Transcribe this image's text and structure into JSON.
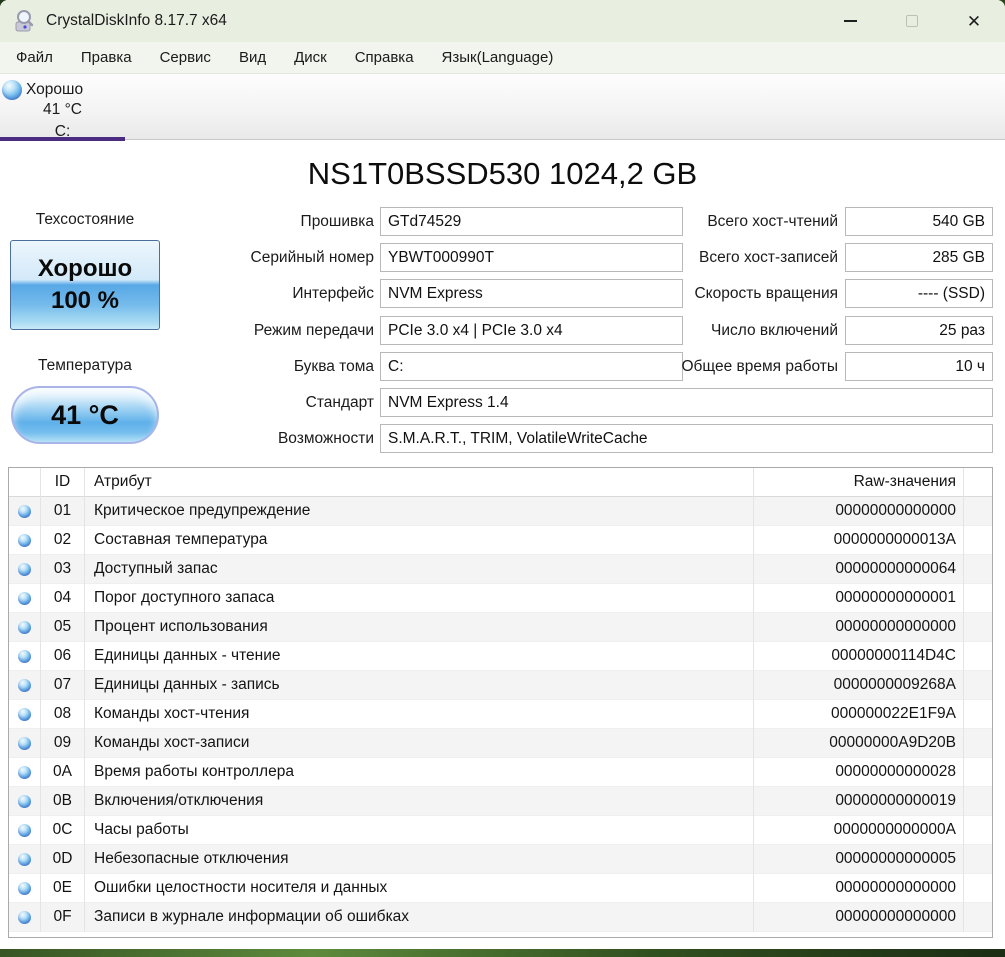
{
  "window": {
    "title": "CrystalDiskInfo 8.17.7 x64",
    "controls": {
      "close": "✕"
    }
  },
  "menu": {
    "items": [
      "Файл",
      "Правка",
      "Сервис",
      "Вид",
      "Диск",
      "Справка",
      "Язык(Language)"
    ]
  },
  "drive_tab": {
    "status": "Хорошо",
    "temperature": "41 °C",
    "letter": "C:"
  },
  "drive": {
    "model_title": "NS1T0BSSD530 1024,2 GB",
    "health": {
      "label": "Техсостояние",
      "status": "Хорошо",
      "percent": "100 %"
    },
    "temperature": {
      "label": "Температура",
      "value": "41 °C"
    },
    "fields_left": [
      {
        "label": "Прошивка",
        "value": "GTd74529"
      },
      {
        "label": "Серийный номер",
        "value": "YBWT000990T"
      },
      {
        "label": "Интерфейс",
        "value": "NVM Express"
      },
      {
        "label": "Режим передачи",
        "value": "PCIe 3.0 x4 | PCIe 3.0 x4"
      },
      {
        "label": "Буква тома",
        "value": "C:"
      },
      {
        "label": "Стандарт",
        "value": "NVM Express 1.4"
      },
      {
        "label": "Возможности",
        "value": "S.M.A.R.T., TRIM, VolatileWriteCache"
      }
    ],
    "fields_right": [
      {
        "label": "Всего хост-чтений",
        "value": "540 GB"
      },
      {
        "label": "Всего хост-записей",
        "value": "285 GB"
      },
      {
        "label": "Скорость вращения",
        "value": "---- (SSD)"
      },
      {
        "label": "Число включений",
        "value": "25 раз"
      },
      {
        "label": "Общее время работы",
        "value": "10 ч"
      }
    ]
  },
  "smart_table": {
    "headers": {
      "id": "ID",
      "attribute": "Атрибут",
      "raw": "Raw-значения"
    },
    "rows": [
      {
        "id": "01",
        "name": "Критическое предупреждение",
        "raw": "00000000000000"
      },
      {
        "id": "02",
        "name": "Составная температура",
        "raw": "0000000000013A"
      },
      {
        "id": "03",
        "name": "Доступный запас",
        "raw": "00000000000064"
      },
      {
        "id": "04",
        "name": "Порог доступного запаса",
        "raw": "00000000000001"
      },
      {
        "id": "05",
        "name": "Процент использования",
        "raw": "00000000000000"
      },
      {
        "id": "06",
        "name": "Единицы данных - чтение",
        "raw": "00000000114D4C"
      },
      {
        "id": "07",
        "name": "Единицы данных - запись",
        "raw": "0000000009268A"
      },
      {
        "id": "08",
        "name": "Команды хост-чтения",
        "raw": "000000022E1F9A"
      },
      {
        "id": "09",
        "name": "Команды хост-записи",
        "raw": "00000000A9D20B"
      },
      {
        "id": "0A",
        "name": "Время работы контроллера",
        "raw": "00000000000028"
      },
      {
        "id": "0B",
        "name": "Включения/отключения",
        "raw": "00000000000019"
      },
      {
        "id": "0C",
        "name": "Часы работы",
        "raw": "0000000000000A"
      },
      {
        "id": "0D",
        "name": "Небезопасные отключения",
        "raw": "00000000000005"
      },
      {
        "id": "0E",
        "name": "Ошибки целостности носителя и данных",
        "raw": "00000000000000"
      },
      {
        "id": "0F",
        "name": "Записи в журнале информации об ошибках",
        "raw": "00000000000000"
      }
    ]
  },
  "colors": {
    "accent_purple": "#4b2b80",
    "health_blue": "#57a8e6",
    "titlebar_bg": "#e8efe1"
  }
}
